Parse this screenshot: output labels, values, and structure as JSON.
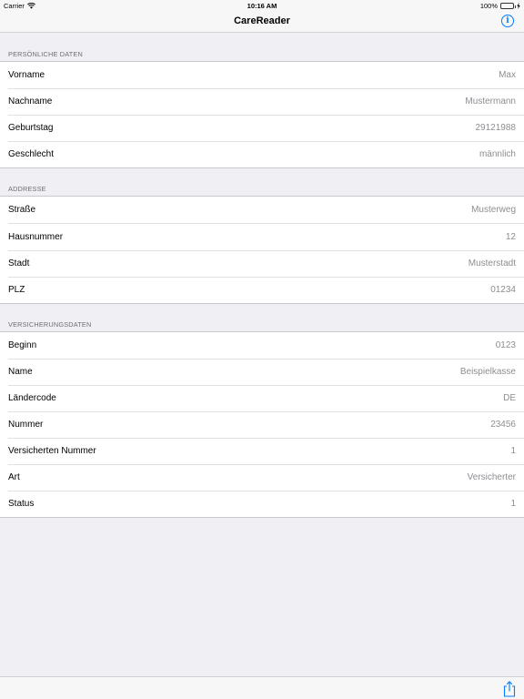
{
  "status_bar": {
    "carrier": "Carrier",
    "time": "10:16 AM",
    "battery": "100%"
  },
  "nav": {
    "title": "CareReader",
    "info_icon": "info-icon"
  },
  "sections": [
    {
      "header": "PERSÖNLICHE DATEN",
      "rows": [
        {
          "label": "Vorname",
          "value": "Max"
        },
        {
          "label": "Nachname",
          "value": "Mustermann"
        },
        {
          "label": "Geburtstag",
          "value": "29121988"
        },
        {
          "label": "Geschlecht",
          "value": "männlich"
        }
      ]
    },
    {
      "header": "ADDRESSE",
      "rows": [
        {
          "label": "Straße",
          "value": "Musterweg"
        },
        {
          "label": "Hausnummer",
          "value": "12"
        },
        {
          "label": "Stadt",
          "value": "Musterstadt"
        },
        {
          "label": "PLZ",
          "value": "01234"
        }
      ]
    },
    {
      "header": "VERSICHERUNGSDATEN",
      "rows": [
        {
          "label": "Beginn",
          "value": "0123"
        },
        {
          "label": "Name",
          "value": "Beispielkasse"
        },
        {
          "label": "Ländercode",
          "value": "DE"
        },
        {
          "label": "Nummer",
          "value": "23456"
        },
        {
          "label": "Versicherten Nummer",
          "value": "1"
        },
        {
          "label": "Art",
          "value": "Versicherter"
        },
        {
          "label": "Status",
          "value": "1"
        }
      ]
    }
  ],
  "colors": {
    "accent": "#007aff",
    "background": "#efeff4",
    "value_text": "#8e8e93"
  }
}
